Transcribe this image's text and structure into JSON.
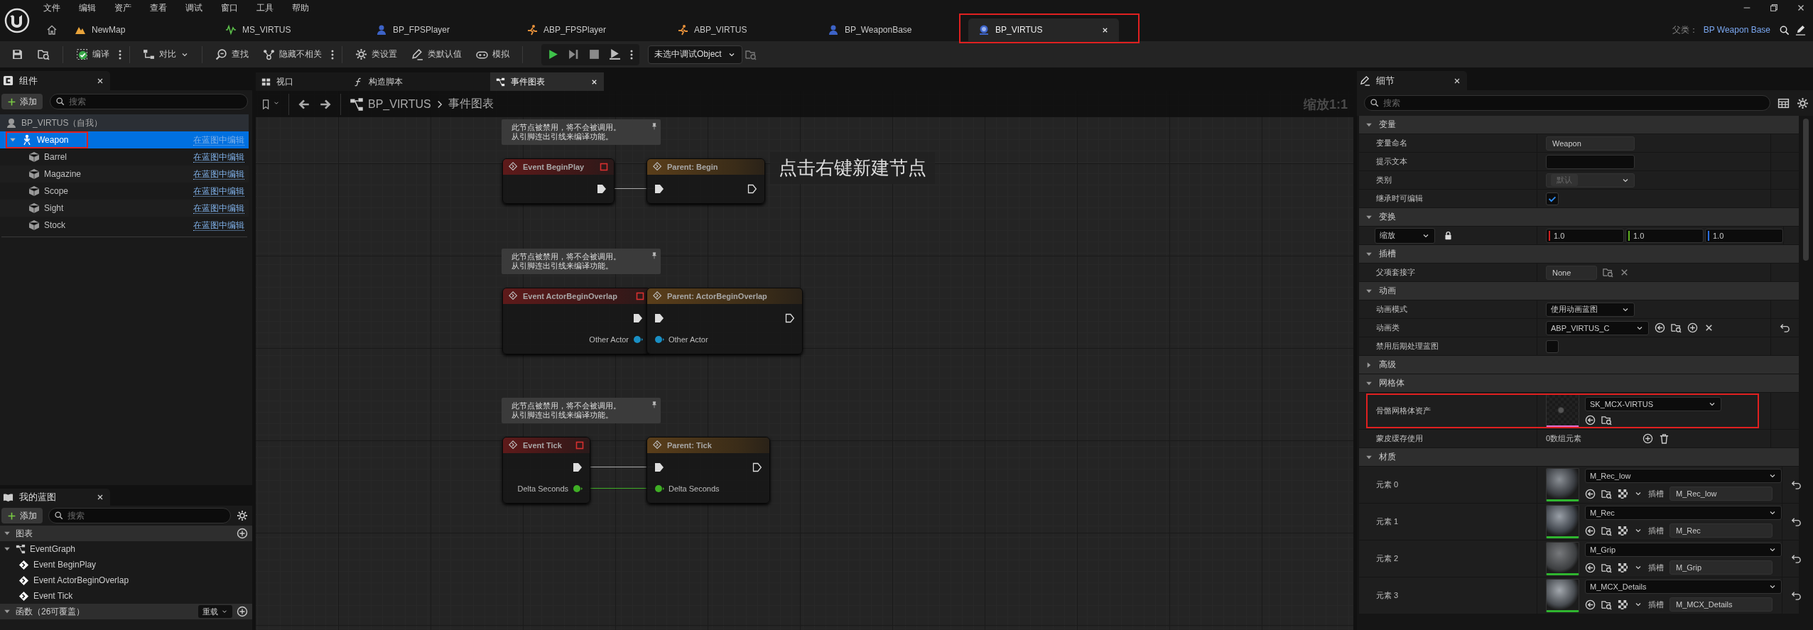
{
  "menu": [
    "文件",
    "编辑",
    "资产",
    "查看",
    "调试",
    "窗口",
    "工具",
    "帮助"
  ],
  "document_tabs": [
    {
      "label": "NewMap",
      "kind": "level",
      "selected": false,
      "highlighted": false
    },
    {
      "label": "MS_VIRTUS",
      "kind": "sound",
      "selected": false,
      "highlighted": false
    },
    {
      "label": "BP_FPSPlayer",
      "kind": "character",
      "selected": false,
      "highlighted": false
    },
    {
      "label": "ABP_FPSPlayer",
      "kind": "animation",
      "selected": false,
      "highlighted": false
    },
    {
      "label": "ABP_VIRTUS",
      "kind": "animation",
      "selected": false,
      "highlighted": false
    },
    {
      "label": "BP_WeaponBase",
      "kind": "character",
      "selected": false,
      "highlighted": false
    },
    {
      "label": "BP_VIRTUS",
      "kind": "blueprint",
      "selected": true,
      "highlighted": true
    }
  ],
  "parent_class": {
    "label": "父类：",
    "value": "BP Weapon Base"
  },
  "toolbar": [
    {
      "kind": "save"
    },
    {
      "kind": "browse"
    },
    {
      "kind": "compile",
      "label": "编译",
      "more": true
    },
    {
      "kind": "diff",
      "label": "对比",
      "dropdown": true
    },
    {
      "kind": "find",
      "label": "查找"
    },
    {
      "kind": "hide",
      "label": "隐藏不相关",
      "more": true
    },
    {
      "kind": "settings",
      "label": "类设置"
    },
    {
      "kind": "defaults",
      "label": "类默认值"
    },
    {
      "kind": "simulate",
      "label": "模拟"
    }
  ],
  "debug_object": "未选中调试Object",
  "components": {
    "title": "组件",
    "add": "添加",
    "search_placeholder": "搜索",
    "root": "BP_VIRTUS（自我）",
    "tree": [
      {
        "label": "Weapon",
        "kind": "skeletal_mesh",
        "selected": true,
        "expanded": true,
        "highlighted": true,
        "link": "在蓝图中编辑",
        "children": [
          {
            "label": "Barrel",
            "kind": "static_mesh",
            "selected": false,
            "highlighted": false,
            "link": "在蓝图中编辑"
          },
          {
            "label": "Magazine",
            "kind": "static_mesh",
            "selected": false,
            "highlighted": false,
            "link": "在蓝图中编辑"
          },
          {
            "label": "Scope",
            "kind": "static_mesh",
            "selected": false,
            "highlighted": false,
            "link": "在蓝图中编辑"
          },
          {
            "label": "Sight",
            "kind": "static_mesh",
            "selected": false,
            "highlighted": false,
            "link": "在蓝图中编辑"
          },
          {
            "label": "Stock",
            "kind": "static_mesh",
            "selected": false,
            "highlighted": false,
            "link": "在蓝图中编辑"
          }
        ]
      }
    ]
  },
  "my_blueprint": {
    "title": "我的蓝图",
    "add": "添加",
    "search_placeholder": "搜索",
    "sections": [
      {
        "title": "图表",
        "expanded": true,
        "items": [
          {
            "label": "EventGraph",
            "kind": "graph",
            "expanded": true,
            "children": [
              {
                "label": "Event BeginPlay",
                "kind": "event"
              },
              {
                "label": "Event ActorBeginOverlap",
                "kind": "event"
              },
              {
                "label": "Event Tick",
                "kind": "event"
              }
            ]
          }
        ]
      },
      {
        "title": "函数（26可覆盖）",
        "expanded": true,
        "action": "重载"
      }
    ]
  },
  "editor_tabs": [
    {
      "label": "视口",
      "kind": "viewport",
      "selected": false
    },
    {
      "label": "构造脚本",
      "kind": "function",
      "selected": false
    },
    {
      "label": "事件图表",
      "kind": "graph",
      "selected": true
    }
  ],
  "graph": {
    "breadcrumb": [
      "BP_VIRTUS",
      "事件图表"
    ],
    "zoom": "缩放1:1",
    "hint": "点击右键新建节点",
    "groups": [
      {
        "comment": "此节点被禁用，将不会被调用。从引脚连出引线来编译功能。",
        "event": {
          "title": "Event BeginPlay"
        },
        "parent": {
          "title": "Parent: Begin"
        }
      },
      {
        "comment": "此节点被禁用，将不会被调用。从引脚连出引线来编译功能。",
        "event": {
          "title": "Event ActorBeginOverlap",
          "pins": [
            {
              "label": "Other Actor",
              "color": "#1a8fc4",
              "connected": true
            }
          ]
        },
        "parent": {
          "title": "Parent: ActorBeginOverlap",
          "pins": [
            {
              "label": "Other Actor",
              "color": "#1a8fc4"
            }
          ]
        }
      },
      {
        "comment": "此节点被禁用，将不会被调用。从引脚连出引线来编译功能。",
        "event": {
          "title": "Event Tick",
          "pins": [
            {
              "label": "Delta Seconds",
              "color": "#3fae25",
              "connected": true
            }
          ]
        },
        "parent": {
          "title": "Parent: Tick",
          "pins": [
            {
              "label": "Delta Seconds",
              "color": "#3fae25"
            }
          ]
        }
      }
    ]
  },
  "details": {
    "title": "细节",
    "search_placeholder": "搜索",
    "rows": [
      {
        "kind": "section",
        "label": "变量",
        "expanded": true
      },
      {
        "kind": "text",
        "label": "变量命名",
        "value": "Weapon"
      },
      {
        "kind": "text",
        "label": "提示文本"
      },
      {
        "kind": "combo",
        "label": "类别",
        "value": "默认",
        "disabled": true
      },
      {
        "kind": "check",
        "label": "继承时可编辑",
        "checked": true
      },
      {
        "kind": "section",
        "label": "变换",
        "expanded": true
      },
      {
        "kind": "vector",
        "mode": "缩放",
        "values": [
          "1.0",
          "1.0",
          "1.0"
        ]
      },
      {
        "kind": "section",
        "label": "插槽",
        "expanded": true
      },
      {
        "kind": "socket",
        "label": "父项套接字",
        "value": "None"
      },
      {
        "kind": "section",
        "label": "动画",
        "expanded": true
      },
      {
        "kind": "combo",
        "label": "动画模式",
        "value": "使用动画蓝图",
        "disabled": false
      },
      {
        "kind": "class",
        "label": "动画类",
        "value": "ABP_VIRTUS_C"
      },
      {
        "kind": "check",
        "label": "禁用后期处理蓝图",
        "checked": false
      },
      {
        "kind": "section",
        "label": "高级",
        "expanded": false
      },
      {
        "kind": "section",
        "label": "网格体",
        "expanded": true
      },
      {
        "kind": "mesh",
        "label": "骨骼网格体资产",
        "value": "SK_MCX-VIRTUS",
        "highlighted": true
      },
      {
        "kind": "array",
        "label": "蒙皮缓存使用",
        "value": "0数组元素"
      },
      {
        "kind": "section",
        "label": "材质",
        "expanded": true
      },
      {
        "kind": "material",
        "label": "元素 0",
        "value": "M_Rec_low",
        "slot_label": "插槽",
        "slot": "M_Rec_low"
      },
      {
        "kind": "material",
        "label": "元素 1",
        "value": "M_Rec",
        "slot_label": "插槽",
        "slot": "M_Rec"
      },
      {
        "kind": "material",
        "label": "元素 2",
        "value": "M_Grip",
        "slot_label": "插槽",
        "slot": "M_Grip"
      },
      {
        "kind": "material",
        "label": "元素 3",
        "value": "M_MCX_Details",
        "slot_label": "插槽",
        "slot": "M_MCX_Details"
      }
    ]
  }
}
